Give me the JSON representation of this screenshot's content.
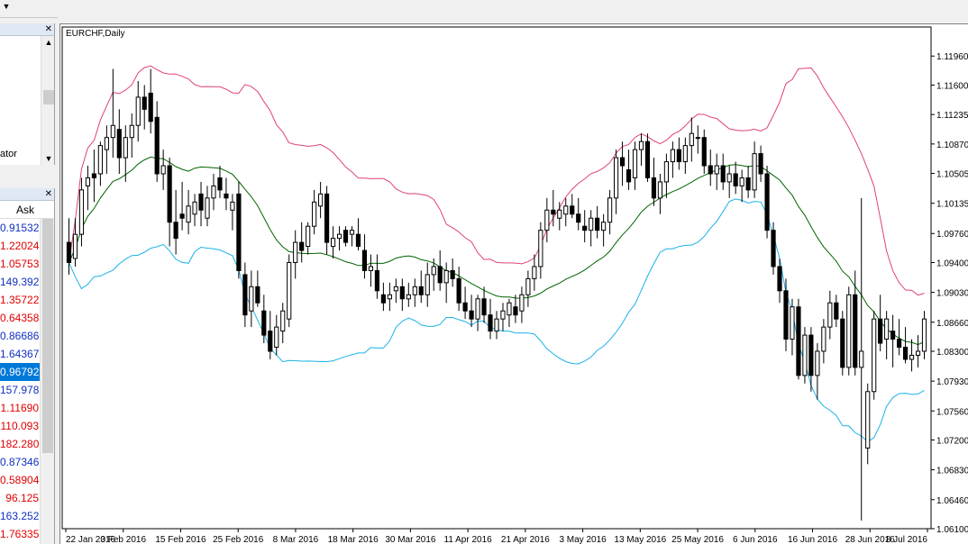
{
  "toolbar": {
    "arrow_icon": "chevron-down-icon"
  },
  "navigator": {
    "visible_text": "ator"
  },
  "market_watch": {
    "column_header": "Ask",
    "rows": [
      {
        "ask": "0.91532",
        "color": "blue"
      },
      {
        "ask": "1.22024",
        "color": "red"
      },
      {
        "ask": "1.05753",
        "color": "red"
      },
      {
        "ask": "149.392",
        "color": "blue"
      },
      {
        "ask": "1.35722",
        "color": "red"
      },
      {
        "ask": "0.64358",
        "color": "red"
      },
      {
        "ask": "0.86686",
        "color": "blue"
      },
      {
        "ask": "1.64367",
        "color": "blue"
      },
      {
        "ask": "0.96792",
        "color": "sel"
      },
      {
        "ask": "157.978",
        "color": "blue"
      },
      {
        "ask": "1.11690",
        "color": "red"
      },
      {
        "ask": "110.093",
        "color": "red"
      },
      {
        "ask": "182.280",
        "color": "red"
      },
      {
        "ask": "0.87346",
        "color": "blue"
      },
      {
        "ask": "0.58904",
        "color": "red"
      },
      {
        "ask": "96.125",
        "color": "red"
      },
      {
        "ask": "163.252",
        "color": "blue"
      },
      {
        "ask": "1.76335",
        "color": "red"
      }
    ]
  },
  "chart": {
    "title": "EURCHF,Daily",
    "colors": {
      "background": "#ffffff",
      "candle": "#000000",
      "middle_band": "#006400",
      "upper_band": "#e0407a",
      "lower_band": "#1ab2e8"
    }
  },
  "chart_data": {
    "type": "candlestick",
    "symbol": "EURCHF",
    "timeframe": "Daily",
    "indicator": "Bollinger Bands",
    "ylim": [
      1.061,
      1.1232
    ],
    "y_ticks": [
      "1.11960",
      "1.11600",
      "1.11235",
      "1.10870",
      "1.10505",
      "1.10135",
      "1.09760",
      "1.09400",
      "1.09030",
      "1.08660",
      "1.08300",
      "1.07930",
      "1.07560",
      "1.07200",
      "1.06830",
      "1.06460",
      "1.06100"
    ],
    "x_ticks": [
      "22 Jan 2016",
      "3 Feb 2016",
      "15 Feb 2016",
      "25 Feb 2016",
      "8 Mar 2016",
      "18 Mar 2016",
      "30 Mar 2016",
      "11 Apr 2016",
      "21 Apr 2016",
      "3 May 2016",
      "13 May 2016",
      "25 May 2016",
      "6 Jun 2016",
      "16 Jun 2016",
      "28 Jun 2016",
      "8 Jul 2016"
    ],
    "candles": [
      [
        1.0965,
        1.0995,
        1.0925,
        1.094
      ],
      [
        1.0945,
        1.0995,
        1.0935,
        1.0975
      ],
      [
        1.0975,
        1.1045,
        1.096,
        1.103
      ],
      [
        1.1035,
        1.106,
        1.1005,
        1.1045
      ],
      [
        1.105,
        1.108,
        1.1015,
        1.1045
      ],
      [
        1.105,
        1.109,
        1.1035,
        1.1085
      ],
      [
        1.108,
        1.111,
        1.105,
        1.1095
      ],
      [
        1.1095,
        1.118,
        1.107,
        1.111
      ],
      [
        1.1105,
        1.113,
        1.105,
        1.107
      ],
      [
        1.107,
        1.111,
        1.104,
        1.1095
      ],
      [
        1.1095,
        1.1125,
        1.107,
        1.111
      ],
      [
        1.111,
        1.1165,
        1.109,
        1.1145
      ],
      [
        1.1145,
        1.116,
        1.1105,
        1.113
      ],
      [
        1.115,
        1.118,
        1.11,
        1.1115
      ],
      [
        1.112,
        1.114,
        1.104,
        1.105
      ],
      [
        1.105,
        1.108,
        1.103,
        1.106
      ],
      [
        1.106,
        1.107,
        1.096,
        1.099
      ],
      [
        1.099,
        1.103,
        1.095,
        1.097
      ],
      [
        1.1,
        1.104,
        1.098,
        1.0995
      ],
      [
        1.099,
        1.103,
        1.0975,
        1.101
      ],
      [
        1.1,
        1.1025,
        1.0985,
        1.1015
      ],
      [
        1.1025,
        1.104,
        1.0985,
        1.1005
      ],
      [
        1.0995,
        1.1035,
        1.0985,
        1.102
      ],
      [
        1.102,
        1.105,
        1.1005,
        1.1035
      ],
      [
        1.1045,
        1.106,
        1.102,
        1.103
      ],
      [
        1.1025,
        1.1045,
        1.1005,
        1.102
      ],
      [
        1.1005,
        1.1025,
        1.098,
        1.1015
      ],
      [
        1.1025,
        1.104,
        1.092,
        1.093
      ],
      [
        1.0925,
        1.094,
        1.086,
        1.0875
      ],
      [
        1.088,
        1.093,
        1.086,
        1.091
      ],
      [
        1.091,
        1.093,
        1.0885,
        1.089
      ],
      [
        1.088,
        1.09,
        1.084,
        1.085
      ],
      [
        1.0855,
        1.088,
        1.082,
        1.083
      ],
      [
        1.0835,
        1.0875,
        1.0825,
        1.086
      ],
      [
        1.0855,
        1.089,
        1.084,
        1.088
      ],
      [
        1.087,
        1.095,
        1.086,
        1.094
      ],
      [
        1.094,
        1.098,
        1.092,
        1.0965
      ],
      [
        1.0965,
        1.099,
        1.094,
        1.0955
      ],
      [
        1.096,
        1.099,
        1.095,
        1.0985
      ],
      [
        1.0985,
        1.103,
        1.0975,
        1.1015
      ],
      [
        1.101,
        1.104,
        1.0995,
        1.1025
      ],
      [
        1.1025,
        1.1035,
        1.095,
        1.0965
      ],
      [
        1.096,
        1.0985,
        1.0945,
        1.097
      ],
      [
        1.097,
        1.0985,
        1.0955,
        1.0975
      ],
      [
        1.098,
        1.0985,
        1.096,
        1.0965
      ],
      [
        1.0975,
        1.0985,
        1.096,
        1.098
      ],
      [
        1.0975,
        1.0995,
        1.0955,
        1.096
      ],
      [
        1.0955,
        1.0975,
        1.092,
        1.093
      ],
      [
        1.093,
        1.095,
        1.091,
        1.0935
      ],
      [
        1.093,
        1.095,
        1.0895,
        1.0905
      ],
      [
        1.09,
        1.0915,
        1.088,
        1.089
      ],
      [
        1.0895,
        1.0915,
        1.088,
        1.09
      ],
      [
        1.0905,
        1.092,
        1.089,
        1.091
      ],
      [
        1.091,
        1.092,
        1.088,
        1.0895
      ],
      [
        1.0895,
        1.0915,
        1.0885,
        1.09
      ],
      [
        1.09,
        1.092,
        1.0885,
        1.091
      ],
      [
        1.091,
        1.093,
        1.089,
        1.09
      ],
      [
        1.09,
        1.094,
        1.0885,
        1.0925
      ],
      [
        1.0925,
        1.0945,
        1.0905,
        1.0935
      ],
      [
        1.0935,
        1.0955,
        1.0905,
        1.0915
      ],
      [
        1.0915,
        1.094,
        1.089,
        1.093
      ],
      [
        1.093,
        1.0945,
        1.091,
        1.092
      ],
      [
        1.092,
        1.0935,
        1.088,
        1.089
      ],
      [
        1.089,
        1.091,
        1.087,
        1.088
      ],
      [
        1.088,
        1.09,
        1.086,
        1.087
      ],
      [
        1.087,
        1.09,
        1.0855,
        1.0895
      ],
      [
        1.0895,
        1.091,
        1.0865,
        1.0875
      ],
      [
        1.0875,
        1.0895,
        1.0845,
        1.0855
      ],
      [
        1.0855,
        1.088,
        1.0845,
        1.087
      ],
      [
        1.087,
        1.089,
        1.0855,
        1.088
      ],
      [
        1.0875,
        1.0895,
        1.086,
        1.089
      ],
      [
        1.0885,
        1.09,
        1.0865,
        1.0875
      ],
      [
        1.088,
        1.091,
        1.0865,
        1.09
      ],
      [
        1.09,
        1.093,
        1.0885,
        1.092
      ],
      [
        1.092,
        1.095,
        1.0905,
        1.0935
      ],
      [
        1.0935,
        1.099,
        1.092,
        1.098
      ],
      [
        1.098,
        1.102,
        1.0965,
        1.1005
      ],
      [
        1.1005,
        1.103,
        1.0985,
        1.1
      ],
      [
        1.0995,
        1.1015,
        1.098,
        1.1005
      ],
      [
        1.1,
        1.102,
        1.0985,
        1.101
      ],
      [
        1.101,
        1.1025,
        1.0995,
        1.1
      ],
      [
        1.1,
        1.102,
        1.098,
        1.099
      ],
      [
        1.0985,
        1.1005,
        1.0965,
        1.098
      ],
      [
        1.098,
        1.1005,
        1.096,
        1.0995
      ],
      [
        1.0995,
        1.101,
        1.097,
        1.098
      ],
      [
        1.098,
        1.1,
        1.096,
        1.099
      ],
      [
        1.099,
        1.103,
        1.0975,
        1.102
      ],
      [
        1.102,
        1.108,
        1.1,
        1.107
      ],
      [
        1.107,
        1.109,
        1.1035,
        1.106
      ],
      [
        1.1055,
        1.108,
        1.103,
        1.104
      ],
      [
        1.1045,
        1.109,
        1.103,
        1.108
      ],
      [
        1.108,
        1.11,
        1.106,
        1.109
      ],
      [
        1.109,
        1.11,
        1.104,
        1.1045
      ],
      [
        1.1045,
        1.107,
        1.101,
        1.102
      ],
      [
        1.102,
        1.105,
        1.1,
        1.104
      ],
      [
        1.104,
        1.1075,
        1.102,
        1.1065
      ],
      [
        1.1065,
        1.109,
        1.1045,
        1.108
      ],
      [
        1.108,
        1.1095,
        1.1055,
        1.1065
      ],
      [
        1.1065,
        1.1095,
        1.105,
        1.1085
      ],
      [
        1.1085,
        1.112,
        1.1065,
        1.11
      ],
      [
        1.1095,
        1.111,
        1.1075,
        1.1095
      ],
      [
        1.1095,
        1.1105,
        1.105,
        1.106
      ],
      [
        1.106,
        1.108,
        1.1035,
        1.105
      ],
      [
        1.105,
        1.1075,
        1.103,
        1.106
      ],
      [
        1.106,
        1.1075,
        1.103,
        1.104
      ],
      [
        1.104,
        1.106,
        1.102,
        1.105
      ],
      [
        1.105,
        1.1065,
        1.1025,
        1.1035
      ],
      [
        1.1035,
        1.1055,
        1.1015,
        1.1045
      ],
      [
        1.1045,
        1.106,
        1.102,
        1.103
      ],
      [
        1.103,
        1.109,
        1.102,
        1.1075
      ],
      [
        1.1075,
        1.1085,
        1.104,
        1.105
      ],
      [
        1.105,
        1.106,
        1.097,
        1.098
      ],
      [
        1.098,
        1.099,
        1.0925,
        1.0935
      ],
      [
        1.0935,
        1.0945,
        1.089,
        1.0905
      ],
      [
        1.0905,
        1.092,
        1.083,
        1.0845
      ],
      [
        1.0845,
        1.0895,
        1.0825,
        1.0885
      ],
      [
        1.0885,
        1.0895,
        1.0795,
        1.08
      ],
      [
        1.08,
        1.086,
        1.079,
        1.085
      ],
      [
        1.085,
        1.086,
        1.078,
        1.08
      ],
      [
        1.08,
        1.084,
        1.077,
        1.083
      ],
      [
        1.083,
        1.087,
        1.0815,
        1.086
      ],
      [
        1.086,
        1.0905,
        1.0845,
        1.089
      ],
      [
        1.089,
        1.09,
        1.086,
        1.087
      ],
      [
        1.087,
        1.088,
        1.08,
        1.081
      ],
      [
        1.081,
        1.091,
        1.08,
        1.09
      ],
      [
        1.09,
        1.093,
        1.08,
        1.081
      ],
      [
        1.081,
        1.102,
        1.062,
        1.083
      ],
      [
        1.071,
        1.079,
        1.069,
        1.078
      ],
      [
        1.078,
        1.088,
        1.077,
        1.087
      ],
      [
        1.087,
        1.09,
        1.083,
        1.084
      ],
      [
        1.0845,
        1.088,
        1.082,
        1.087
      ],
      [
        1.0855,
        1.0875,
        1.081,
        1.0845
      ],
      [
        1.0845,
        1.087,
        1.0825,
        1.0835
      ],
      [
        1.0835,
        1.086,
        1.0815,
        1.082
      ],
      [
        1.082,
        1.0845,
        1.0805,
        1.0825
      ],
      [
        1.0825,
        1.085,
        1.081,
        1.083
      ],
      [
        1.083,
        1.088,
        1.082,
        1.087
      ]
    ]
  }
}
